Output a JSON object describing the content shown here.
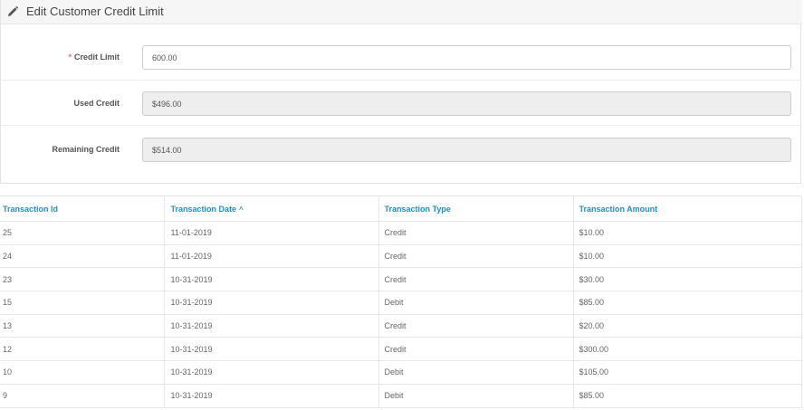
{
  "panel": {
    "title": "Edit Customer Credit Limit",
    "icon": "pencil-icon"
  },
  "form": {
    "credit_limit": {
      "label": "Credit Limit",
      "required_mark": "*",
      "value": "600.00"
    },
    "used_credit": {
      "label": "Used Credit",
      "value": "$496.00"
    },
    "remaining_credit": {
      "label": "Remaining Credit",
      "value": "$514.00"
    }
  },
  "table": {
    "columns": [
      {
        "label": "Transaction Id"
      },
      {
        "label": "Transaction Date",
        "sort_icon": "chevron-up-icon",
        "sort_glyph": "^"
      },
      {
        "label": "Transaction Type"
      },
      {
        "label": "Transaction Amount"
      }
    ],
    "rows": [
      {
        "id": "25",
        "date": "11-01-2019",
        "type": "Credit",
        "amount": "$10.00"
      },
      {
        "id": "24",
        "date": "11-01-2019",
        "type": "Credit",
        "amount": "$10.00"
      },
      {
        "id": "23",
        "date": "10-31-2019",
        "type": "Credit",
        "amount": "$30.00"
      },
      {
        "id": "15",
        "date": "10-31-2019",
        "type": "Debit",
        "amount": "$85.00"
      },
      {
        "id": "13",
        "date": "10-31-2019",
        "type": "Credit",
        "amount": "$20.00"
      },
      {
        "id": "12",
        "date": "10-31-2019",
        "type": "Credit",
        "amount": "$300.00"
      },
      {
        "id": "10",
        "date": "10-31-2019",
        "type": "Debit",
        "amount": "$105.00"
      },
      {
        "id": "9",
        "date": "10-31-2019",
        "type": "Debit",
        "amount": "$85.00"
      }
    ]
  },
  "colors": {
    "link_blue": "#1e91cf",
    "required_red": "#f56b6b",
    "readonly_bg": "#eeeeee"
  }
}
